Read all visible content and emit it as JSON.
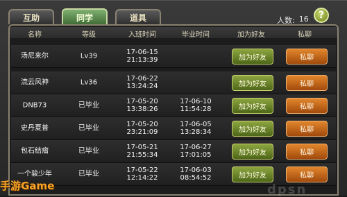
{
  "tabs": [
    {
      "label": "互助"
    },
    {
      "label": "同学"
    },
    {
      "label": "道具"
    }
  ],
  "count": {
    "label": "人数:",
    "value": "16"
  },
  "help_symbol": "?",
  "columns": [
    "名称",
    "等级",
    "入班时间",
    "毕业时间",
    "加为好友",
    "私聊"
  ],
  "rows": [
    {
      "name": "汤尼来尔",
      "level": "Lv39",
      "join_date": "17-06-15",
      "join_time": "21:13:39",
      "grad_date": "",
      "grad_time": "",
      "add_label": "加为好友",
      "chat_label": "私聊"
    },
    {
      "name": "流云风神",
      "level": "Lv36",
      "join_date": "17-06-22",
      "join_time": "13:24:24",
      "grad_date": "",
      "grad_time": "",
      "add_label": "加为好友",
      "chat_label": "私聊"
    },
    {
      "name": "DNB73",
      "level": "已毕业",
      "join_date": "17-05-20",
      "join_time": "13:38:26",
      "grad_date": "17-06-10",
      "grad_time": "11:54:28",
      "add_label": "加为好友",
      "chat_label": "私聊"
    },
    {
      "name": "史丹夏普",
      "level": "已毕业",
      "join_date": "17-05-20",
      "join_time": "23:21:09",
      "grad_date": "17-06-05",
      "grad_time": "13:28:34",
      "add_label": "加为好友",
      "chat_label": "私聊"
    },
    {
      "name": "包石结瘤",
      "level": "已毕业",
      "join_date": "17-05-21",
      "join_time": "21:55:34",
      "grad_date": "17-06-27",
      "grad_time": "17:01:05",
      "add_label": "加为好友",
      "chat_label": "私聊"
    },
    {
      "name": "一个骏少年",
      "level": "已毕业",
      "join_date": "17-05-22",
      "join_time": "12:14:22",
      "grad_date": "17-06-03",
      "grad_time": "08:54:52",
      "add_label": "加为好友",
      "chat_label": "私聊"
    }
  ],
  "watermark": "手游Game",
  "watermark2": "dpsn"
}
